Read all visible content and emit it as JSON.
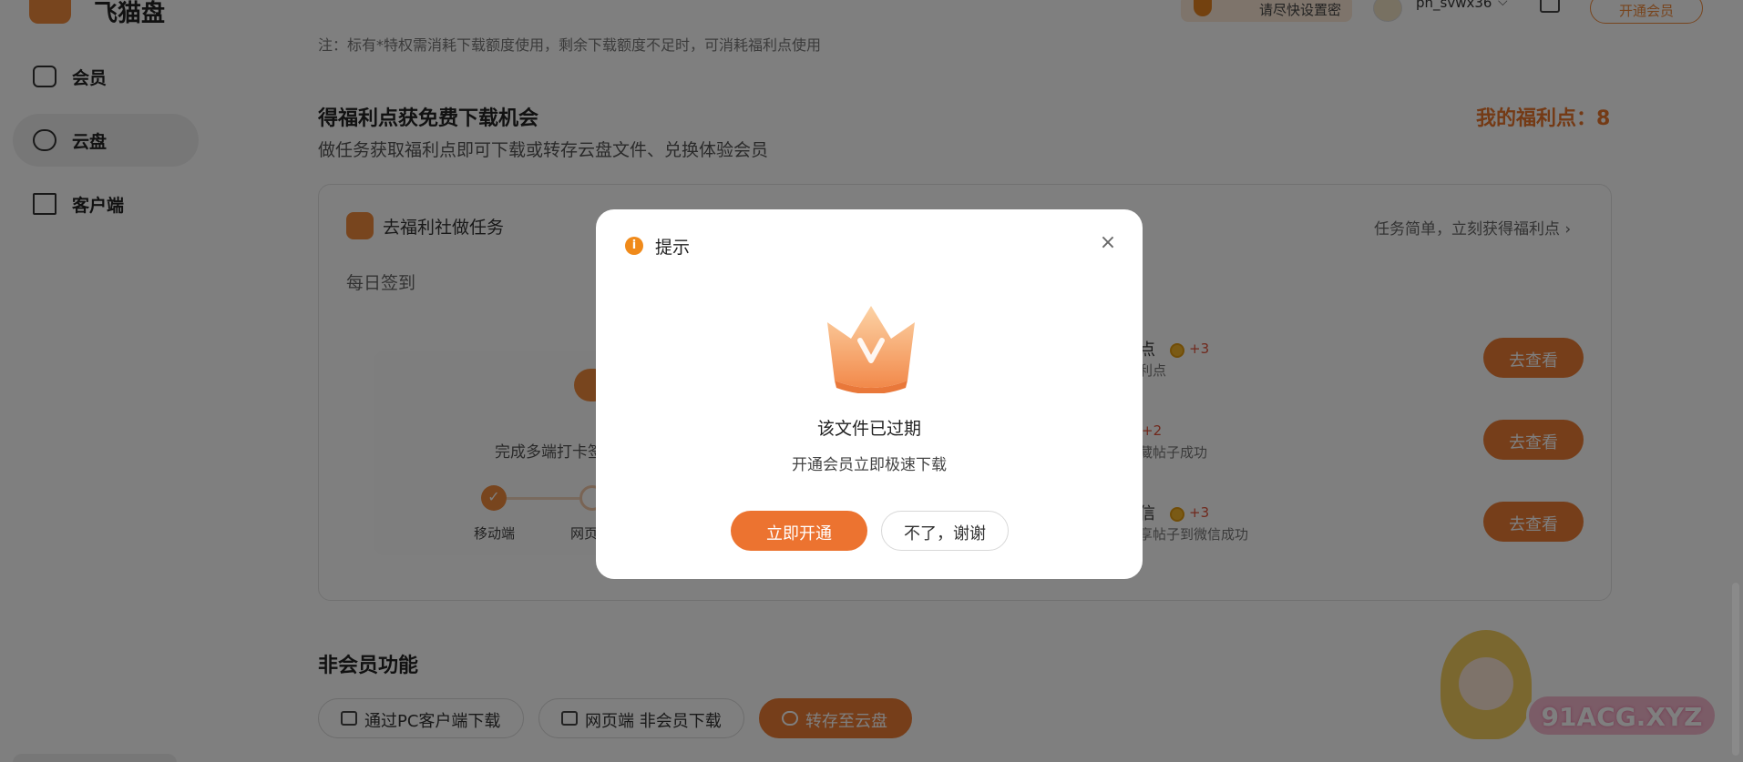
{
  "header": {
    "logo_text": "飞猫盘",
    "pwd_warning": "请尽快设置密",
    "username": "ph_svwx36",
    "vip_button": "开通会员"
  },
  "sidebar": {
    "items": [
      {
        "label": "会员",
        "icon": "vip-icon"
      },
      {
        "label": "云盘",
        "icon": "cloud-icon"
      },
      {
        "label": "客户端",
        "icon": "client-icon"
      }
    ]
  },
  "main": {
    "note": "注：标有*特权需消耗下载额度使用，剩余下载额度不足时，可消耗福利点使用",
    "welfare_title": "得福利点获免费下载机会",
    "welfare_subtitle": "做任务获取福利点即可下载或转存云盘文件、兑换体验会员",
    "my_points": "我的福利点：8",
    "task_header": "去福利社做任务",
    "task_link": "任务简单，立刻获得福利点 ›",
    "daily_signin": "每日签到",
    "multi_checkin": "完成多端打卡签",
    "steps": [
      "移动端",
      "网页"
    ],
    "tasks": [
      {
        "name": "点",
        "points": "+3",
        "desc": "利点",
        "button": "去查看"
      },
      {
        "name": "",
        "points": "+2",
        "desc": "藏帖子成功",
        "button": "去查看"
      },
      {
        "name": "信",
        "points": "+3",
        "desc": "享帖子到微信成功",
        "button": "去查看"
      }
    ],
    "nonmember_title": "非会员功能",
    "download_buttons": [
      {
        "label": "通过PC客户端下载",
        "icon": "monitor-icon"
      },
      {
        "label": "网页端 非会员下载",
        "icon": "browser-icon"
      },
      {
        "label": "转存至云盘",
        "icon": "cloud-icon"
      }
    ]
  },
  "watermark": "91ACG.XYZ",
  "modal": {
    "title": "提示",
    "close": "×",
    "message": "该文件已过期",
    "submessage": "开通会员立即极速下载",
    "confirm_button": "立即开通",
    "cancel_button": "不了，谢谢"
  },
  "colors": {
    "accent": "#ec7c34",
    "points": "#e8742b",
    "overlay": "rgba(0,0,0,0.5)"
  }
}
